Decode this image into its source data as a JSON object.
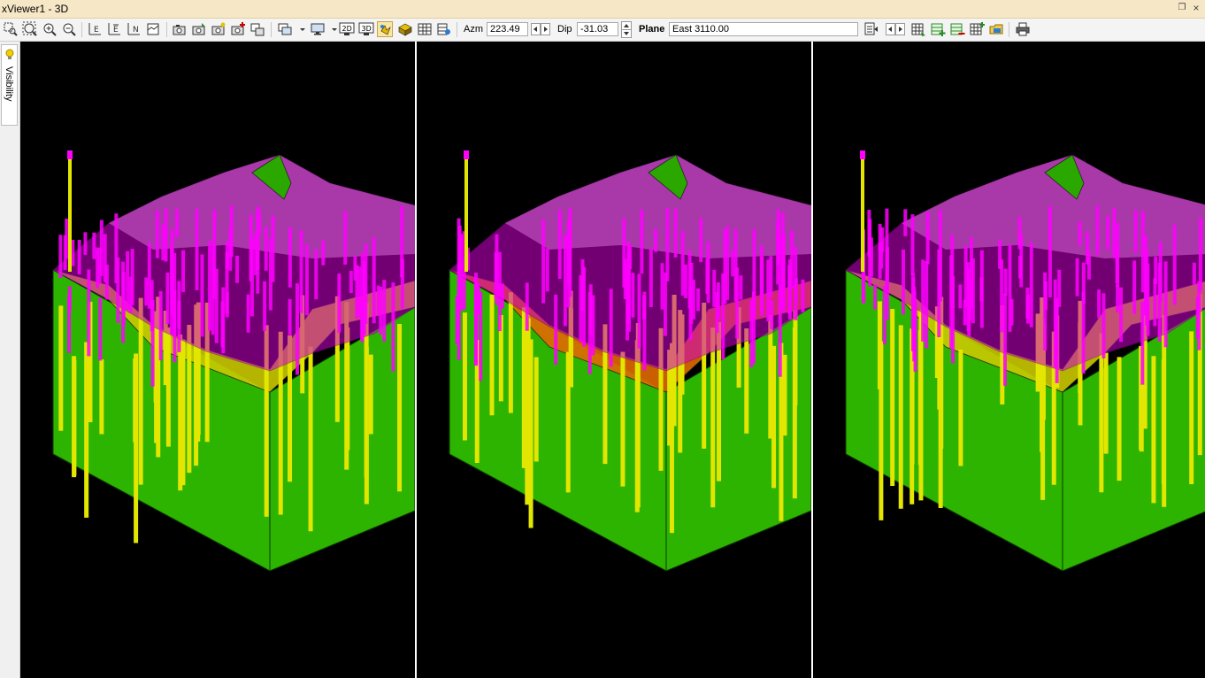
{
  "window": {
    "title": "xViewer1 - 3D"
  },
  "toolbar": {
    "azm_label": "Azm",
    "azm_value": "223.49",
    "dip_label": "Dip",
    "dip_value": "-31.03",
    "plane_label": "Plane",
    "plane_value": "East 3110.00",
    "mode_2d": "2D",
    "mode_3d": "3D"
  },
  "sidebar": {
    "visibility_label": "Visibility"
  },
  "viewports": [
    {
      "name": "viewport-left",
      "surface_color": "#c9c800"
    },
    {
      "name": "viewport-center",
      "surface_color": "#e06a00"
    },
    {
      "name": "viewport-right",
      "surface_color": "#c9c800"
    }
  ],
  "colors": {
    "window_title_bg": "#f6e7c6",
    "toolbar_bg": "#f4f4f4",
    "viewport_bg": "#000000",
    "block_green": "#2db400",
    "topo_magenta": "#d000d0",
    "drillhole_yellow": "#e2e600",
    "drillhole_magenta": "#ff00ff"
  }
}
